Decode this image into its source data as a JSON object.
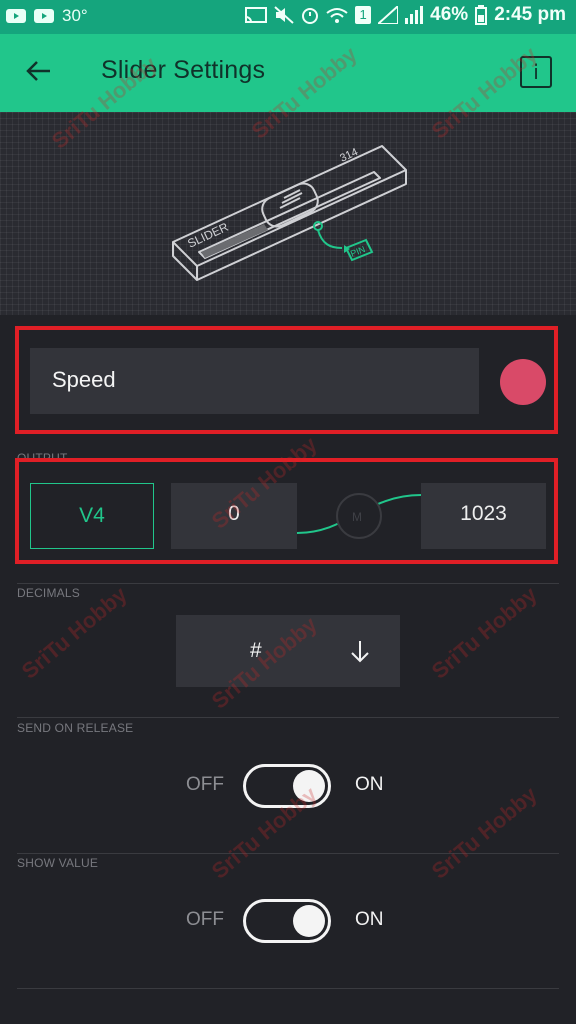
{
  "status_bar": {
    "temperature": "30°",
    "battery": "46%",
    "time": "2:45 pm",
    "sim_label": "1"
  },
  "app_bar": {
    "title": "Slider Settings",
    "back_icon": "arrow-left-icon",
    "info_label": "i"
  },
  "illustration": {
    "slider_label": "SLIDER",
    "value_label": "314",
    "pin_label": "PIN"
  },
  "name_field": {
    "value": "Speed",
    "color": "#d94a68"
  },
  "output": {
    "label": "OUTPUT",
    "pin": "V4",
    "min": "0",
    "max": "1023"
  },
  "decimals": {
    "label": "DECIMALS",
    "value": "#",
    "dropdown_icon": "arrow-down-icon"
  },
  "send_on_release": {
    "label": "SEND ON RELEASE",
    "off": "OFF",
    "on": "ON",
    "state": "on"
  },
  "show_value": {
    "label": "SHOW VALUE",
    "off": "OFF",
    "on": "ON",
    "state": "on"
  },
  "watermark": "SriTu Hobby",
  "colors": {
    "accent": "#21c68b",
    "status_bar": "#15a57d",
    "background": "#212227",
    "highlight": "#e01f26"
  }
}
